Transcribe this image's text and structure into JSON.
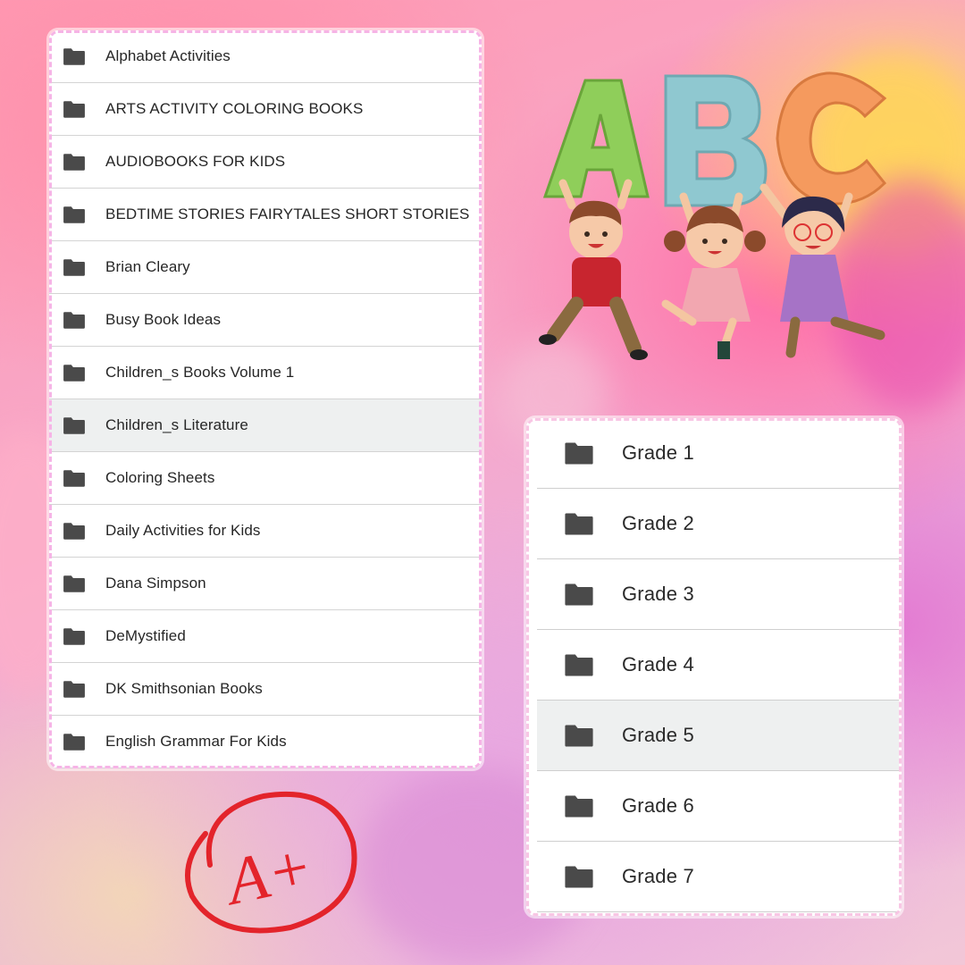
{
  "left_list": {
    "items": [
      {
        "label": "Alphabet Activities",
        "selected": false
      },
      {
        "label": "ARTS ACTIVITY COLORING BOOKS",
        "selected": false
      },
      {
        "label": "AUDIOBOOKS FOR KIDS",
        "selected": false
      },
      {
        "label": "BEDTIME STORIES FAIRYTALES SHORT STORIES",
        "selected": false
      },
      {
        "label": "Brian Cleary",
        "selected": false
      },
      {
        "label": "Busy Book Ideas",
        "selected": false
      },
      {
        "label": "Children_s Books Volume 1",
        "selected": false
      },
      {
        "label": "Children_s Literature",
        "selected": true
      },
      {
        "label": "Coloring Sheets",
        "selected": false
      },
      {
        "label": "Daily Activities for Kids",
        "selected": false
      },
      {
        "label": "Dana Simpson",
        "selected": false
      },
      {
        "label": "DeMystified",
        "selected": false
      },
      {
        "label": "DK Smithsonian Books",
        "selected": false
      },
      {
        "label": "English Grammar For Kids",
        "selected": false
      }
    ]
  },
  "right_list": {
    "items": [
      {
        "label": "Grade 1",
        "selected": false
      },
      {
        "label": "Grade 2",
        "selected": false
      },
      {
        "label": "Grade 3",
        "selected": false
      },
      {
        "label": "Grade 4",
        "selected": false
      },
      {
        "label": "Grade 5",
        "selected": true
      },
      {
        "label": "Grade 6",
        "selected": false
      },
      {
        "label": "Grade 7",
        "selected": false
      }
    ]
  },
  "illustration": {
    "letters": [
      "A",
      "B",
      "C"
    ],
    "letter_colors": [
      "#8fce5a",
      "#8fc8d0",
      "#f59a5e"
    ]
  },
  "badge": {
    "text": "A+",
    "color": "#e3242b"
  },
  "icons": {
    "folder": "folder-icon"
  },
  "colors": {
    "folder_icon": "#4a4a4a",
    "selected_row": "#eef0f0"
  }
}
